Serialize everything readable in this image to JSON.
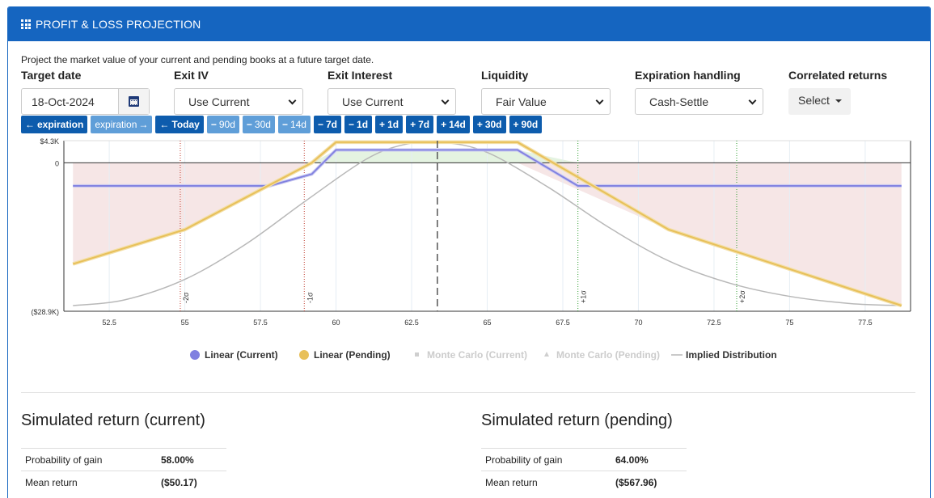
{
  "header": {
    "title": "PROFIT & LOSS PROJECTION",
    "icon": "grid-icon"
  },
  "intro": "Project the market value of your current and pending books at a future target date.",
  "controls": {
    "target_date": {
      "label": "Target date",
      "value": "18-Oct-2024"
    },
    "exit_iv": {
      "label": "Exit IV",
      "value": "Use Current"
    },
    "exit_interest": {
      "label": "Exit Interest",
      "value": "Use Current"
    },
    "liquidity": {
      "label": "Liquidity",
      "value": "Fair Value"
    },
    "expiration_handling": {
      "label": "Expiration handling",
      "value": "Cash-Settle"
    },
    "correlated_returns": {
      "label": "Correlated returns",
      "value": "Select"
    }
  },
  "time_buttons": [
    {
      "label": "expiration",
      "icon": "arrow-left",
      "style": "dark"
    },
    {
      "label": "expiration",
      "icon": "arrow-right",
      "style": "light"
    },
    {
      "label": "Today",
      "icon": "arrow-left",
      "style": "dark"
    },
    {
      "label": "90d",
      "icon": "minus",
      "style": "light"
    },
    {
      "label": "30d",
      "icon": "minus",
      "style": "light"
    },
    {
      "label": "14d",
      "icon": "minus",
      "style": "light"
    },
    {
      "label": "7d",
      "icon": "minus",
      "style": "dark"
    },
    {
      "label": "1d",
      "icon": "minus",
      "style": "dark"
    },
    {
      "label": "1d",
      "icon": "plus",
      "style": "dark"
    },
    {
      "label": "7d",
      "icon": "plus",
      "style": "dark"
    },
    {
      "label": "14d",
      "icon": "plus",
      "style": "dark"
    },
    {
      "label": "30d",
      "icon": "plus",
      "style": "dark"
    },
    {
      "label": "90d",
      "icon": "plus",
      "style": "dark"
    }
  ],
  "chart_data": {
    "type": "line",
    "xlim": [
      51,
      79
    ],
    "ylim": [
      -28900,
      4300
    ],
    "x_ticks": [
      52.5,
      55,
      57.5,
      60,
      62.5,
      65,
      67.5,
      70,
      72.5,
      75,
      77.5
    ],
    "x_tick_labels": [
      "52.5",
      "55",
      "57.5",
      "60",
      "62.5",
      "65",
      "67.5",
      "70",
      "72.5",
      "75",
      "77.5"
    ],
    "y_ticks": [
      4300,
      0,
      -28900
    ],
    "y_tick_labels": [
      "$4.3K",
      "0",
      "($28.9K)"
    ],
    "current_price": 63.35,
    "sigma_lines": [
      {
        "x": 54.85,
        "label": "-2σ",
        "color": "#c0392b"
      },
      {
        "x": 58.95,
        "label": "-1σ",
        "color": "#c0392b"
      },
      {
        "x": 68.0,
        "label": "+1σ",
        "color": "#2e9e2e"
      },
      {
        "x": 73.25,
        "label": "+2σ",
        "color": "#2e9e2e"
      }
    ],
    "series": [
      {
        "name": "Linear (Current)",
        "color": "#8080e0",
        "marker": "circle",
        "x": [
          51.3,
          57.8,
          59.2,
          60.0,
          66.0,
          68.0,
          78.7
        ],
        "y": [
          -4500,
          -4500,
          -2200,
          2500,
          2500,
          -4500,
          -4500
        ]
      },
      {
        "name": "Linear (Pending)",
        "color": "#e8c05a",
        "marker": "circle",
        "x": [
          51.3,
          55.0,
          59.2,
          60.0,
          66.0,
          71.0,
          78.7
        ],
        "y": [
          -19700,
          -13000,
          0,
          4000,
          4000,
          -13000,
          -27800
        ]
      },
      {
        "name": "Monte Carlo (Current)",
        "color": "#cfcfcf",
        "marker": "square",
        "x": [],
        "y": []
      },
      {
        "name": "Monte Carlo (Pending)",
        "color": "#cfcfcf",
        "marker": "triangle",
        "x": [],
        "y": []
      },
      {
        "name": "Implied Distribution",
        "color": "#b8b8b8",
        "marker": "line",
        "x": [
          51.3,
          53,
          55,
          57,
          59,
          61,
          62.3,
          63.5,
          65,
          67,
          69,
          71,
          73,
          75,
          77,
          78.7
        ],
        "y": [
          -27800,
          -26700,
          -22700,
          -15900,
          -7400,
          700,
          3600,
          4000,
          2000,
          -4700,
          -12500,
          -19100,
          -23400,
          -26000,
          -27400,
          -27800
        ]
      }
    ],
    "legend_position": "bottom"
  },
  "sim_current": {
    "title": "Simulated return (current)",
    "rows": [
      {
        "label": "Probability of gain",
        "value": "58.00%"
      },
      {
        "label": "Mean return",
        "value": "($50.17)"
      }
    ]
  },
  "sim_pending": {
    "title": "Simulated return (pending)",
    "rows": [
      {
        "label": "Probability of gain",
        "value": "64.00%"
      },
      {
        "label": "Mean return",
        "value": "($567.96)"
      }
    ]
  }
}
